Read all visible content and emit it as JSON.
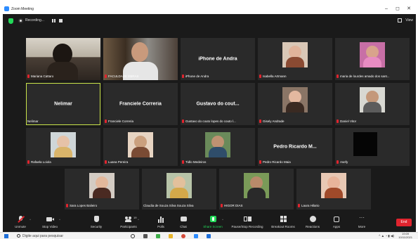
{
  "window": {
    "title": "Zoom Meeting",
    "minimize": "–",
    "maximize": "◻",
    "close": "✕"
  },
  "topbar": {
    "recording_label": "Recording...",
    "view_label": "View"
  },
  "participants": [
    {
      "name": "Mariana Cattaro",
      "muted": true
    },
    {
      "name": "FACULDADE EBRAS",
      "muted": true
    },
    {
      "name": "iPhone de Andra",
      "center": "iPhone de Andra",
      "muted": true
    },
    {
      "name": "Isabella Artmann",
      "muted": true
    },
    {
      "name": "maria de lourdes amado dos sant...",
      "muted": true
    },
    {
      "name": "Nelimar",
      "center": "Nelimar",
      "muted": false
    },
    {
      "name": "Franciele Correria",
      "center": "Franciele Correria",
      "muted": true
    },
    {
      "name": "Gustavo do couto lopes do couto l...",
      "center": "Gustavo do cout...",
      "muted": true
    },
    {
      "name": "Gisely Andrade",
      "muted": true
    },
    {
      "name": "Daniel Vitor",
      "muted": true
    },
    {
      "name": "Rafaela Loiola",
      "muted": true
    },
    {
      "name": "Luana Pereira",
      "muted": true
    },
    {
      "name": "Tidlo Medeiros",
      "muted": true
    },
    {
      "name": "Pedro Ricardo Maia",
      "center": "Pedro Ricardo M...",
      "muted": true
    },
    {
      "name": "Asefy",
      "muted": true
    },
    {
      "name": "Sara Lopes Balieiro",
      "muted": true
    },
    {
      "name": "Claudia de Souza Silva Souza Silva",
      "muted": false
    },
    {
      "name": "HIGOR DIAS",
      "muted": true
    },
    {
      "name": "Laura Hilario",
      "muted": true
    }
  ],
  "toolbar": {
    "unmute": "Unmute",
    "stop_video": "Stop Video",
    "security": "Security",
    "participants": "Participants",
    "participants_count": "19",
    "polls": "Polls",
    "chat": "Chat",
    "share_screen": "Share Screen",
    "pause_recording": "Pause/Stop Recording",
    "breakout_rooms": "Breakout Rooms",
    "reactions": "Reactions",
    "apps": "Apps",
    "more": "More",
    "end": "End"
  },
  "taskbar": {
    "search_placeholder": "Digite aqui para pesquisar",
    "time": "19:09",
    "date": "10/11/2021"
  },
  "colors": {
    "accent": "#2d8cff",
    "active_speaker": "#c9e44a",
    "mic_muted": "#e0242e",
    "share_green": "#23d959",
    "end_red": "#e0242e"
  }
}
